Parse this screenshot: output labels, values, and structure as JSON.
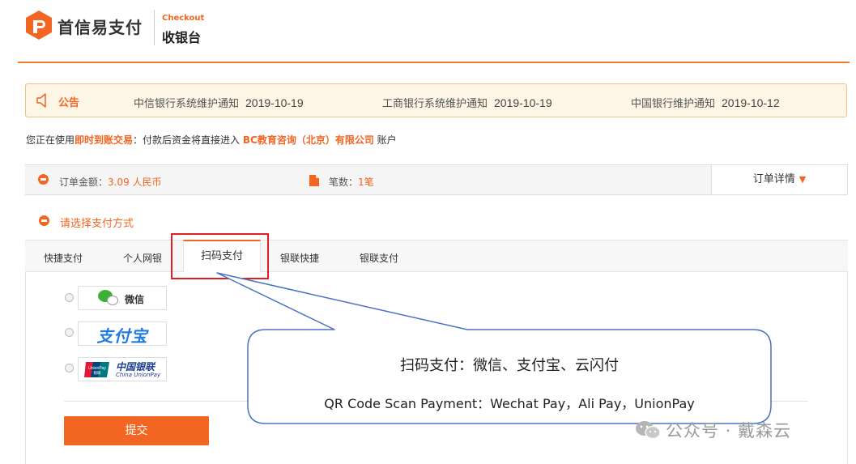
{
  "header": {
    "brand": "首信易支付",
    "checkout_en": "Checkout",
    "checkout_cn": "收银台",
    "accent_color": "#f26522"
  },
  "notice": {
    "label": "公告",
    "items": [
      {
        "text": "中信银行系统维护通知",
        "date": "2019-10-19"
      },
      {
        "text": "工商银行系统维护通知",
        "date": "2019-10-19"
      },
      {
        "text": "中国银行维护通知",
        "date": "2019-10-12"
      }
    ]
  },
  "account": {
    "prefix": "您正在使用",
    "mode": "即时到账交易",
    "middle": "：付款后资金将直接进入",
    "merchant": "BC教育咨询（北京）有限公司",
    "suffix": "账户"
  },
  "order": {
    "amount_label": "订单金额：",
    "amount_value": "3.09 人民币",
    "count_label": "笔数：",
    "count_value": "1笔",
    "detail_button": "订单详情",
    "detail_caret": "▼"
  },
  "payment": {
    "section_title": "请选择支付方式",
    "tabs": [
      "快捷支付",
      "个人网银",
      "扫码支付",
      "银联快捷",
      "银联支付"
    ],
    "active_tab": "扫码支付",
    "options": [
      {
        "icon": "wechat-logo-icon",
        "label": "微信"
      },
      {
        "icon": "alipay-logo-icon",
        "label": "支付宝"
      },
      {
        "icon": "unionpay-logo-icon",
        "label": "中国银联",
        "sublabel": "China UnionPay",
        "mark_top": "UnionPay",
        "mark_bottom": "银联"
      }
    ],
    "submit": "提交"
  },
  "callout": {
    "cn": "扫码支付：微信、支付宝、云闪付",
    "en": "QR Code Scan Payment：Wechat Pay，Ali Pay，UnionPay"
  },
  "watermark": {
    "text": "公众号 · 戴森云"
  }
}
